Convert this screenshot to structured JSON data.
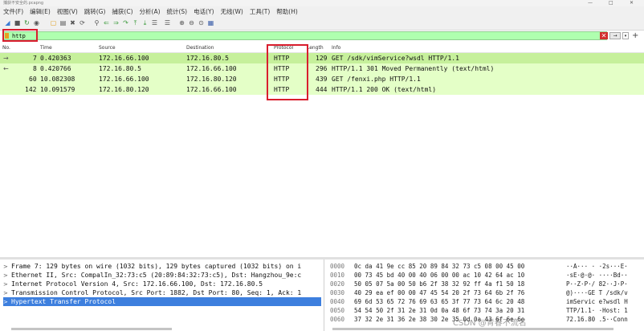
{
  "window": {
    "title": "捕获不安全的.pcapng",
    "min": "—",
    "max": "□",
    "close": "✕"
  },
  "menu": [
    "文件(F)",
    "编辑(E)",
    "视图(V)",
    "跳转(G)",
    "捕获(C)",
    "分析(A)",
    "统计(S)",
    "电话(Y)",
    "无线(W)",
    "工具(T)",
    "帮助(H)"
  ],
  "filter": {
    "value": "http",
    "clear": "✕",
    "apply": "→",
    "dropdown": "▾",
    "add": "+",
    "color": "#afffaf"
  },
  "columns": {
    "no": "No.",
    "time": "Time",
    "source": "Source",
    "destination": "Destination",
    "protocol": "Protocol",
    "length": "Length",
    "info": "Info"
  },
  "packets": [
    {
      "no": "7",
      "time": "0.420363",
      "src": "172.16.66.100",
      "dst": "172.16.80.5",
      "proto": "HTTP",
      "len": "129",
      "info": "GET /sdk/vimService?wsdl HTTP/1.1",
      "ctrl": "→"
    },
    {
      "no": "8",
      "time": "0.420766",
      "src": "172.16.80.5",
      "dst": "172.16.66.100",
      "proto": "HTTP",
      "len": "296",
      "info": "HTTP/1.1 301 Moved Permanently  (text/html)",
      "ctrl": "←"
    },
    {
      "no": "60",
      "time": "10.082308",
      "src": "172.16.66.100",
      "dst": "172.16.80.120",
      "proto": "HTTP",
      "len": "439",
      "info": "GET /fenxi.php HTTP/1.1",
      "ctrl": ""
    },
    {
      "no": "142",
      "time": "10.091579",
      "src": "172.16.80.120",
      "dst": "172.16.66.100",
      "proto": "HTTP",
      "len": "444",
      "info": "HTTP/1.1 200 OK  (text/html)",
      "ctrl": ""
    }
  ],
  "details": [
    "Frame 7: 129 bytes on wire (1032 bits), 129 bytes captured (1032 bits) on i",
    "Ethernet II, Src: CompalIn_32:73:c5 (20:89:84:32:73:c5), Dst: Hangzhou_9e:c",
    "Internet Protocol Version 4, Src: 172.16.66.100, Dst: 172.16.80.5",
    "Transmission Control Protocol, Src Port: 1882, Dst Port: 80, Seq: 1, Ack: 1",
    "Hypertext Transfer Protocol"
  ],
  "hex": [
    {
      "off": "0000",
      "bytes": "0c da 41 9e cc 85 20 89  84 32 73 c5 08 00 45 00",
      "ascii": "··A··· · ·2s···E·"
    },
    {
      "off": "0010",
      "bytes": "00 73 45 bd 40 00 40 06  00 00 ac 10 42 64 ac 10",
      "ascii": "·sE·@·@· ····Bd··"
    },
    {
      "off": "0020",
      "bytes": "50 05 07 5a 00 50 b6 2f  38 32 92 ff 4a f1 50 18",
      "ascii": "P··Z·P·/ 82··J·P·"
    },
    {
      "off": "0030",
      "bytes": "40 29 ea ef 00 00 47 45  54 20 2f 73 64 6b 2f 76",
      "ascii": "@)····GE T /sdk/v"
    },
    {
      "off": "0040",
      "bytes": "69 6d 53 65 72 76 69 63  65 3f 77 73 64 6c 20 48",
      "ascii": "imServic e?wsdl H"
    },
    {
      "off": "0050",
      "bytes": "54 54 50 2f 31 2e 31 0d  0a 48 6f 73 74 3a 20 31",
      "ascii": "TTP/1.1· ·Host: 1"
    },
    {
      "off": "0060",
      "bytes": "37 32 2e 31 36 2e 38 30  2e 35 0d 0a 43 6f 6e 6e",
      "ascii": "72.16.80 .5··Conn"
    }
  ],
  "watermark": "CSDN @青春不流名",
  "colors": {
    "row_bg": "#e4ffc7",
    "row_selected": "#c6f09b",
    "highlight_box": "#d91e2e",
    "detail_selected": "#3d7fde"
  }
}
